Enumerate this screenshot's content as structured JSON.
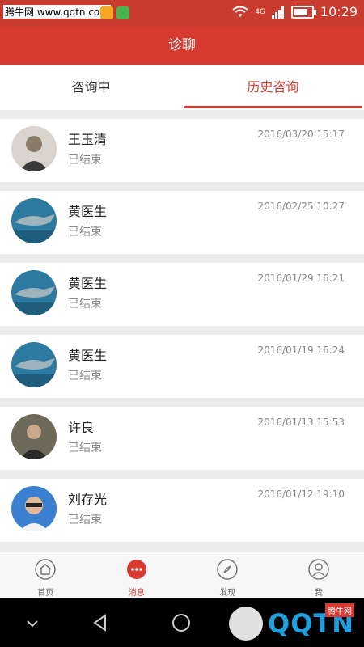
{
  "status_bar": {
    "watermark_text": "腾牛网 www.qqtn.com",
    "network": "4G",
    "time": "10:29"
  },
  "header": {
    "title": "诊聊"
  },
  "tabs": [
    {
      "label": "咨询中",
      "active": false
    },
    {
      "label": "历史咨询",
      "active": true
    }
  ],
  "consultations": [
    {
      "name": "王玉清",
      "status": "已结束",
      "time": "2016/03/20 15:17",
      "avatar": "person-photo"
    },
    {
      "name": "黄医生",
      "status": "已结束",
      "time": "2016/02/25 10:27",
      "avatar": "shark-photo"
    },
    {
      "name": "黄医生",
      "status": "已结束",
      "time": "2016/01/29 16:21",
      "avatar": "shark-photo"
    },
    {
      "name": "黄医生",
      "status": "已结束",
      "time": "2016/01/19 16:24",
      "avatar": "shark-photo"
    },
    {
      "name": "许良",
      "status": "已结束",
      "time": "2016/01/13 15:53",
      "avatar": "person-photo"
    },
    {
      "name": "刘存光",
      "status": "已结束",
      "time": "2016/01/12 19:10",
      "avatar": "person-photo"
    }
  ],
  "bottom_nav": [
    {
      "label": "首页",
      "icon": "home-icon",
      "active": false
    },
    {
      "label": "消息",
      "icon": "chat-icon",
      "active": true
    },
    {
      "label": "发现",
      "icon": "compass-icon",
      "active": false
    },
    {
      "label": "我",
      "icon": "user-icon",
      "active": false
    }
  ],
  "watermark": {
    "brand": "QQTN",
    "tag": "腾牛网"
  },
  "colors": {
    "primary": "#d73a31",
    "text": "#222222",
    "muted": "#888888"
  }
}
